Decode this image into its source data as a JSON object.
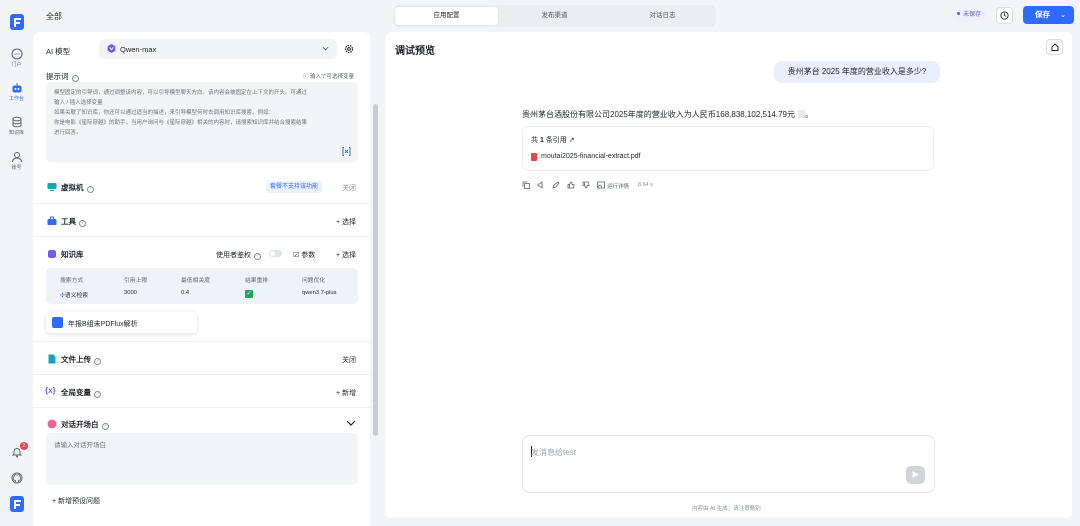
{
  "rail": {
    "items": [
      {
        "label": "门户",
        "icon": "chat-bubble-icon"
      },
      {
        "label": "工作台",
        "icon": "robot-icon",
        "active": true
      },
      {
        "label": "知识库",
        "icon": "database-icon"
      },
      {
        "label": "账号",
        "icon": "user-icon"
      }
    ],
    "notification_count": "2"
  },
  "topbar": {
    "breadcrumb": "全部",
    "tabs": [
      "应用配置",
      "发布渠道",
      "对话日志"
    ],
    "active_tab": "应用配置",
    "status": "未保存",
    "save_label": "保存"
  },
  "config": {
    "model_label": "AI 模型",
    "model_value": "Qwen-max",
    "prompt_label": "提示词",
    "prompt_hint": "输入\"/\"可选择变量",
    "prompt_text": [
      "模型固定的引导词，通过调整该内容，可以引导模型聊天方向。该内容会被固定在上下文的开头。可通过",
      "输入 / 插入选择变量",
      "如果关联了知识库，你还可以通过适当的描述，来引导模型何时去调用知识库搜索。例如：",
      "你是电影《星际穿越》的助手，当用户询问与《星际穿越》相关的内容时，请搜索知识库并结合搜索结果",
      "进行回答。"
    ],
    "vm_label": "虚拟机",
    "vm_tag": "套餐不支持该功能",
    "vm_action": "关闭",
    "tools_label": "工具",
    "tools_action": "+ 选择",
    "kb_label": "知识库",
    "kb_auth_label": "使用者鉴权",
    "kb_params": "参数",
    "kb_select": "+ 选择",
    "kb_table": {
      "headers": [
        "搜索方式",
        "引用上限",
        "最低相关度",
        "结果重排",
        "问题优化"
      ],
      "row": [
        "语义检索",
        "3000",
        "0.4",
        "",
        "qwen3.7-plus"
      ]
    },
    "kb_file": "年报B组未PDFlux解析",
    "upload_label": "文件上传",
    "upload_action": "关闭",
    "vars_label": "全局变量",
    "vars_action": "+ 新增",
    "opening_label": "对话开场白",
    "opening_placeholder": "请输入对话开场白",
    "add_question": "+ 新增预设问题"
  },
  "preview": {
    "title": "调试预览",
    "question": "贵州茅台 2025 年度的营业收入是多少?",
    "answer": "贵州茅台酒股份有限公司2025年度的营业收入为人民币168,838,102,514.79元",
    "answer_end": "。",
    "cite_prefix": "共",
    "cite_count": "1",
    "cite_suffix": "条引用",
    "cite_file": "moutai2025-financial-extract.pdf",
    "run_detail": "运行详情",
    "duration": "8.64 s",
    "composer_placeholder": "发消息给test",
    "footnote": "内容由 AI 生成，请注意甄别"
  },
  "colors": {
    "accent": "#2f6bff",
    "danger": "#e5484d",
    "ok": "#22a35a"
  }
}
